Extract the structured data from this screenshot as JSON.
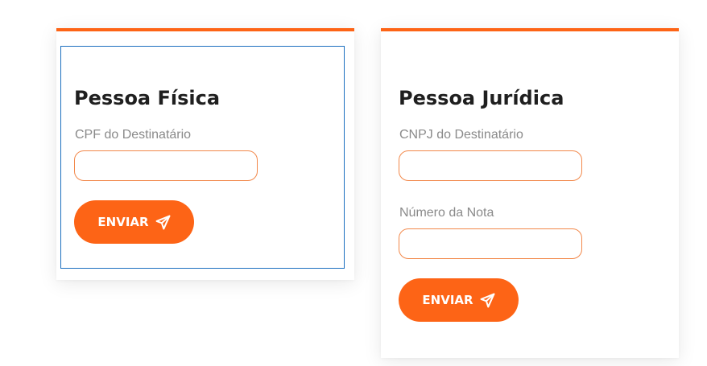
{
  "theme": {
    "accent": "#fd6416",
    "field_border": "#f2884a",
    "focus_outline": "#1c6fbf",
    "title_color": "#1f1f1f",
    "label_color": "#8a8a8a"
  },
  "pessoa_fisica": {
    "title": "Pessoa Física",
    "cpf_label": "CPF do Destinatário",
    "cpf_value": "",
    "cpf_placeholder": "",
    "submit_label": "ENVIAR",
    "submit_icon": "paper-plane-icon"
  },
  "pessoa_juridica": {
    "title": "Pessoa Jurídica",
    "cnpj_label": "CNPJ do Destinatário",
    "cnpj_value": "",
    "cnpj_placeholder": "",
    "nota_label": "Número da Nota",
    "nota_value": "",
    "nota_placeholder": "",
    "submit_label": "ENVIAR",
    "submit_icon": "paper-plane-icon"
  }
}
